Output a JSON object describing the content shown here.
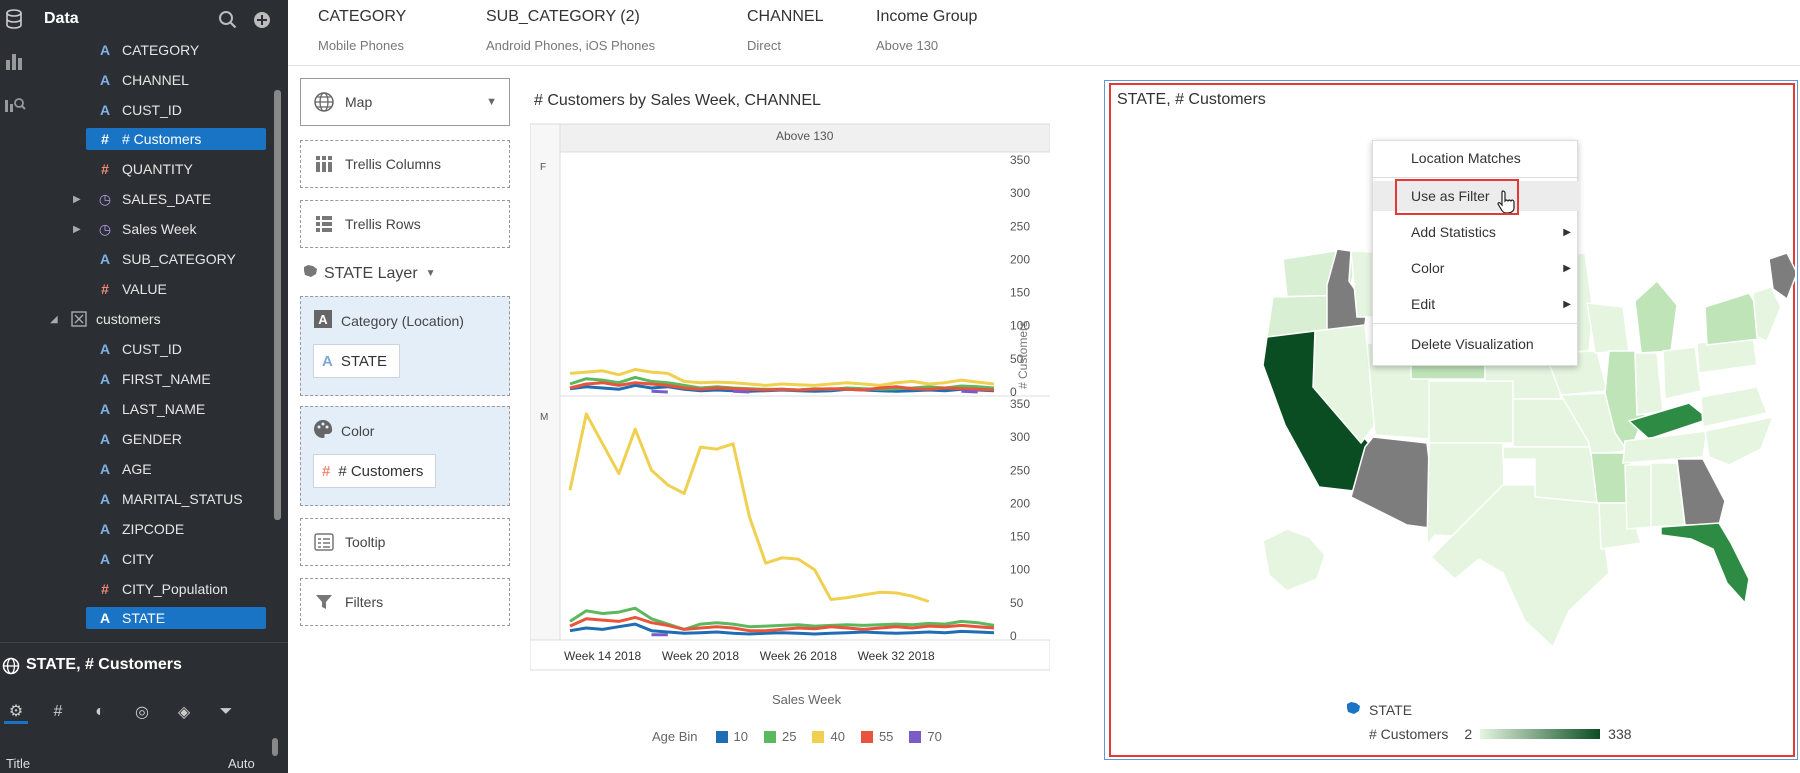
{
  "data_panel": {
    "title": "Data",
    "items": [
      {
        "label": "CATEGORY",
        "type": "A"
      },
      {
        "label": "CHANNEL",
        "type": "A"
      },
      {
        "label": "CUST_ID",
        "type": "A"
      },
      {
        "label": "# Customers",
        "type": "hash",
        "selected": true
      },
      {
        "label": "QUANTITY",
        "type": "hash"
      },
      {
        "label": "SALES_DATE",
        "type": "clock"
      },
      {
        "label": "Sales Week",
        "type": "clock"
      },
      {
        "label": "SUB_CATEGORY",
        "type": "A"
      },
      {
        "label": "VALUE",
        "type": "hash"
      }
    ],
    "group": {
      "label": "customers"
    },
    "group_items": [
      {
        "label": "CUST_ID",
        "type": "A"
      },
      {
        "label": "FIRST_NAME",
        "type": "A"
      },
      {
        "label": "LAST_NAME",
        "type": "A"
      },
      {
        "label": "GENDER",
        "type": "A"
      },
      {
        "label": "AGE",
        "type": "A"
      },
      {
        "label": "MARITAL_STATUS",
        "type": "A"
      },
      {
        "label": "ZIPCODE",
        "type": "A"
      },
      {
        "label": "CITY",
        "type": "A"
      },
      {
        "label": "CITY_Population",
        "type": "hash"
      },
      {
        "label": "STATE",
        "type": "A",
        "selected": true
      }
    ]
  },
  "viz_properties": {
    "title": "STATE, # Customers",
    "row_label": "Title",
    "row_value": "Auto"
  },
  "filters": [
    {
      "name": "CATEGORY",
      "value": "Mobile Phones"
    },
    {
      "name": "SUB_CATEGORY (2)",
      "value": "Android Phones, iOS Phones"
    },
    {
      "name": "CHANNEL",
      "value": "Direct"
    },
    {
      "name": "Income Group",
      "value": "Above 130"
    }
  ],
  "grammar": {
    "viz_type": "Map",
    "trellis_columns": "Trellis Columns",
    "trellis_rows": "Trellis Rows",
    "layer": "STATE Layer",
    "category_label": "Category (Location)",
    "category_value": "STATE",
    "color_label": "Color",
    "color_value": "# Customers",
    "tooltip": "Tooltip",
    "filters": "Filters"
  },
  "line_chart_ui": {
    "title": "# Customers by Sales Week, CHANNEL",
    "column_header": "Above 130",
    "row_headers": [
      "F",
      "M"
    ],
    "x_axis_label": "Sales Week",
    "y_axis_label": "# Customers",
    "legend_title": "Age Bin"
  },
  "chart_data": {
    "type": "line",
    "title": "# Customers by Sales Week, CHANNEL",
    "xlabel": "Sales Week",
    "ylabel": "# Customers",
    "ylim": [
      0,
      350
    ],
    "yticks": [
      0,
      50,
      100,
      150,
      200,
      250,
      300,
      350
    ],
    "x_tick_labels": [
      "Week 14 2018",
      "Week 20 2018",
      "Week 26 2018",
      "Week 32 2018"
    ],
    "x_tick_positions": [
      2,
      8,
      14,
      20
    ],
    "n_weeks": 27,
    "legend": {
      "title": "Age Bin",
      "placement": "bottom"
    },
    "panels": [
      {
        "row": "F",
        "series": [
          {
            "name": "10",
            "color": "#1f6db3",
            "values": [
              5,
              8,
              6,
              4,
              10,
              6,
              8,
              4,
              2,
              3,
              2,
              1,
              2,
              3,
              2,
              1,
              2,
              4,
              3,
              2,
              1,
              2,
              3,
              2,
              4,
              3,
              2
            ]
          },
          {
            "name": "25",
            "color": "#5cb85c",
            "values": [
              12,
              20,
              18,
              14,
              22,
              16,
              14,
              10,
              6,
              8,
              6,
              5,
              4,
              4,
              3,
              5,
              4,
              6,
              5,
              4,
              5,
              6,
              8,
              6,
              9,
              8,
              6
            ]
          },
          {
            "name": "40",
            "color": "#f0d050",
            "values": [
              28,
              30,
              32,
              26,
              34,
              30,
              28,
              16,
              14,
              15,
              14,
              12,
              10,
              12,
              11,
              10,
              12,
              14,
              12,
              10,
              14,
              16,
              12,
              14,
              18,
              15,
              12
            ]
          },
          {
            "name": "55",
            "color": "#e8553c",
            "values": [
              6,
              12,
              14,
              10,
              14,
              12,
              10,
              6,
              4,
              6,
              5,
              4,
              3,
              4,
              3,
              4,
              5,
              4,
              3,
              6,
              8,
              5,
              4,
              6,
              5,
              4,
              3
            ]
          },
          {
            "name": "70",
            "color": "#7b5cc7",
            "values": [
              0,
              null,
              null,
              null,
              null,
              1,
              0,
              null,
              null,
              null,
              1,
              0,
              null,
              null,
              null,
              null,
              null,
              null,
              null,
              null,
              null,
              null,
              null,
              null,
              1,
              0,
              null
            ]
          }
        ]
      },
      {
        "row": "M",
        "series": [
          {
            "name": "10",
            "color": "#1f6db3",
            "values": [
              8,
              12,
              10,
              14,
              18,
              8,
              6,
              4,
              5,
              6,
              4,
              3,
              4,
              5,
              4,
              3,
              4,
              5,
              6,
              5,
              4,
              5,
              6,
              5,
              7,
              6,
              5
            ]
          },
          {
            "name": "25",
            "color": "#5cb85c",
            "values": [
              22,
              38,
              34,
              36,
              42,
              26,
              18,
              10,
              18,
              20,
              18,
              14,
              15,
              16,
              17,
              15,
              16,
              17,
              16,
              17,
              18,
              17,
              19,
              18,
              22,
              20,
              16
            ]
          },
          {
            "name": "40",
            "color": "#f0d050",
            "values": [
              220,
              335,
              290,
              245,
              312,
              250,
              228,
              215,
              285,
              282,
              290,
              180,
              110,
              118,
              116,
              100,
              55,
              58,
              62,
              66,
              65,
              60,
              52
            ]
          },
          {
            "name": "55",
            "color": "#e8553c",
            "values": [
              15,
              26,
              24,
              22,
              28,
              20,
              16,
              10,
              12,
              14,
              12,
              8,
              8,
              10,
              12,
              11,
              14,
              12,
              10,
              12,
              14,
              12,
              15,
              14,
              16,
              14,
              12
            ]
          },
          {
            "name": "70",
            "color": "#7b5cc7",
            "values": [
              0,
              null,
              null,
              null,
              null,
              2,
              2,
              null,
              null,
              null,
              null,
              null,
              null,
              null,
              null,
              null,
              null,
              null,
              null,
              null,
              null,
              null,
              null,
              null,
              null,
              null,
              null
            ]
          }
        ]
      }
    ]
  },
  "map_panel": {
    "title": "STATE, # Customers",
    "legend_layer": "STATE",
    "legend_measure": "# Customers",
    "legend_min": "2",
    "legend_max": "338",
    "color_low": "#e5f5e0",
    "color_high": "#0b4d23",
    "no_data_color": "#7d7d7d"
  },
  "context_menu": {
    "items": [
      {
        "label": "Location Matches",
        "submenu": false
      },
      {
        "label": "Use as Filter",
        "submenu": false,
        "hovered": true
      },
      {
        "label": "Add Statistics",
        "submenu": true
      },
      {
        "label": "Color",
        "submenu": true
      },
      {
        "label": "Edit",
        "submenu": true
      },
      {
        "label": "Delete Visualization",
        "submenu": false
      }
    ]
  }
}
